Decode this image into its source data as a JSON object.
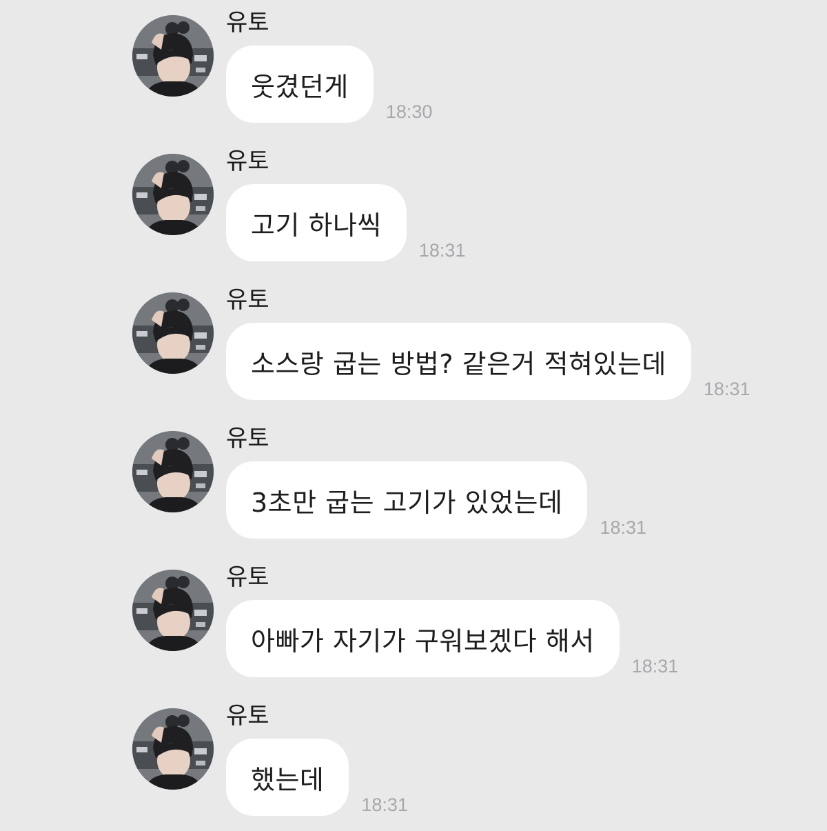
{
  "chat": {
    "messages": [
      {
        "sender": "유토",
        "text": "웃겼던게",
        "time": "18:30",
        "avatar_icon": "profile-photo"
      },
      {
        "sender": "유토",
        "text": "고기 하나씩",
        "time": "18:31",
        "avatar_icon": "profile-photo"
      },
      {
        "sender": "유토",
        "text": "소스랑 굽는 방법? 같은거 적혀있는데",
        "time": "18:31",
        "avatar_icon": "profile-photo"
      },
      {
        "sender": "유토",
        "text": "3초만 굽는 고기가 있었는데",
        "time": "18:31",
        "avatar_icon": "profile-photo"
      },
      {
        "sender": "유토",
        "text": "아빠가 자기가 구워보겠다 해서",
        "time": "18:31",
        "avatar_icon": "profile-photo"
      },
      {
        "sender": "유토",
        "text": "했는데",
        "time": "18:31",
        "avatar_icon": "profile-photo"
      }
    ]
  },
  "colors": {
    "background": "#e9e9ea",
    "bubble": "#ffffff",
    "text": "#1d1d1d",
    "timestamp": "#a7a8ab"
  }
}
